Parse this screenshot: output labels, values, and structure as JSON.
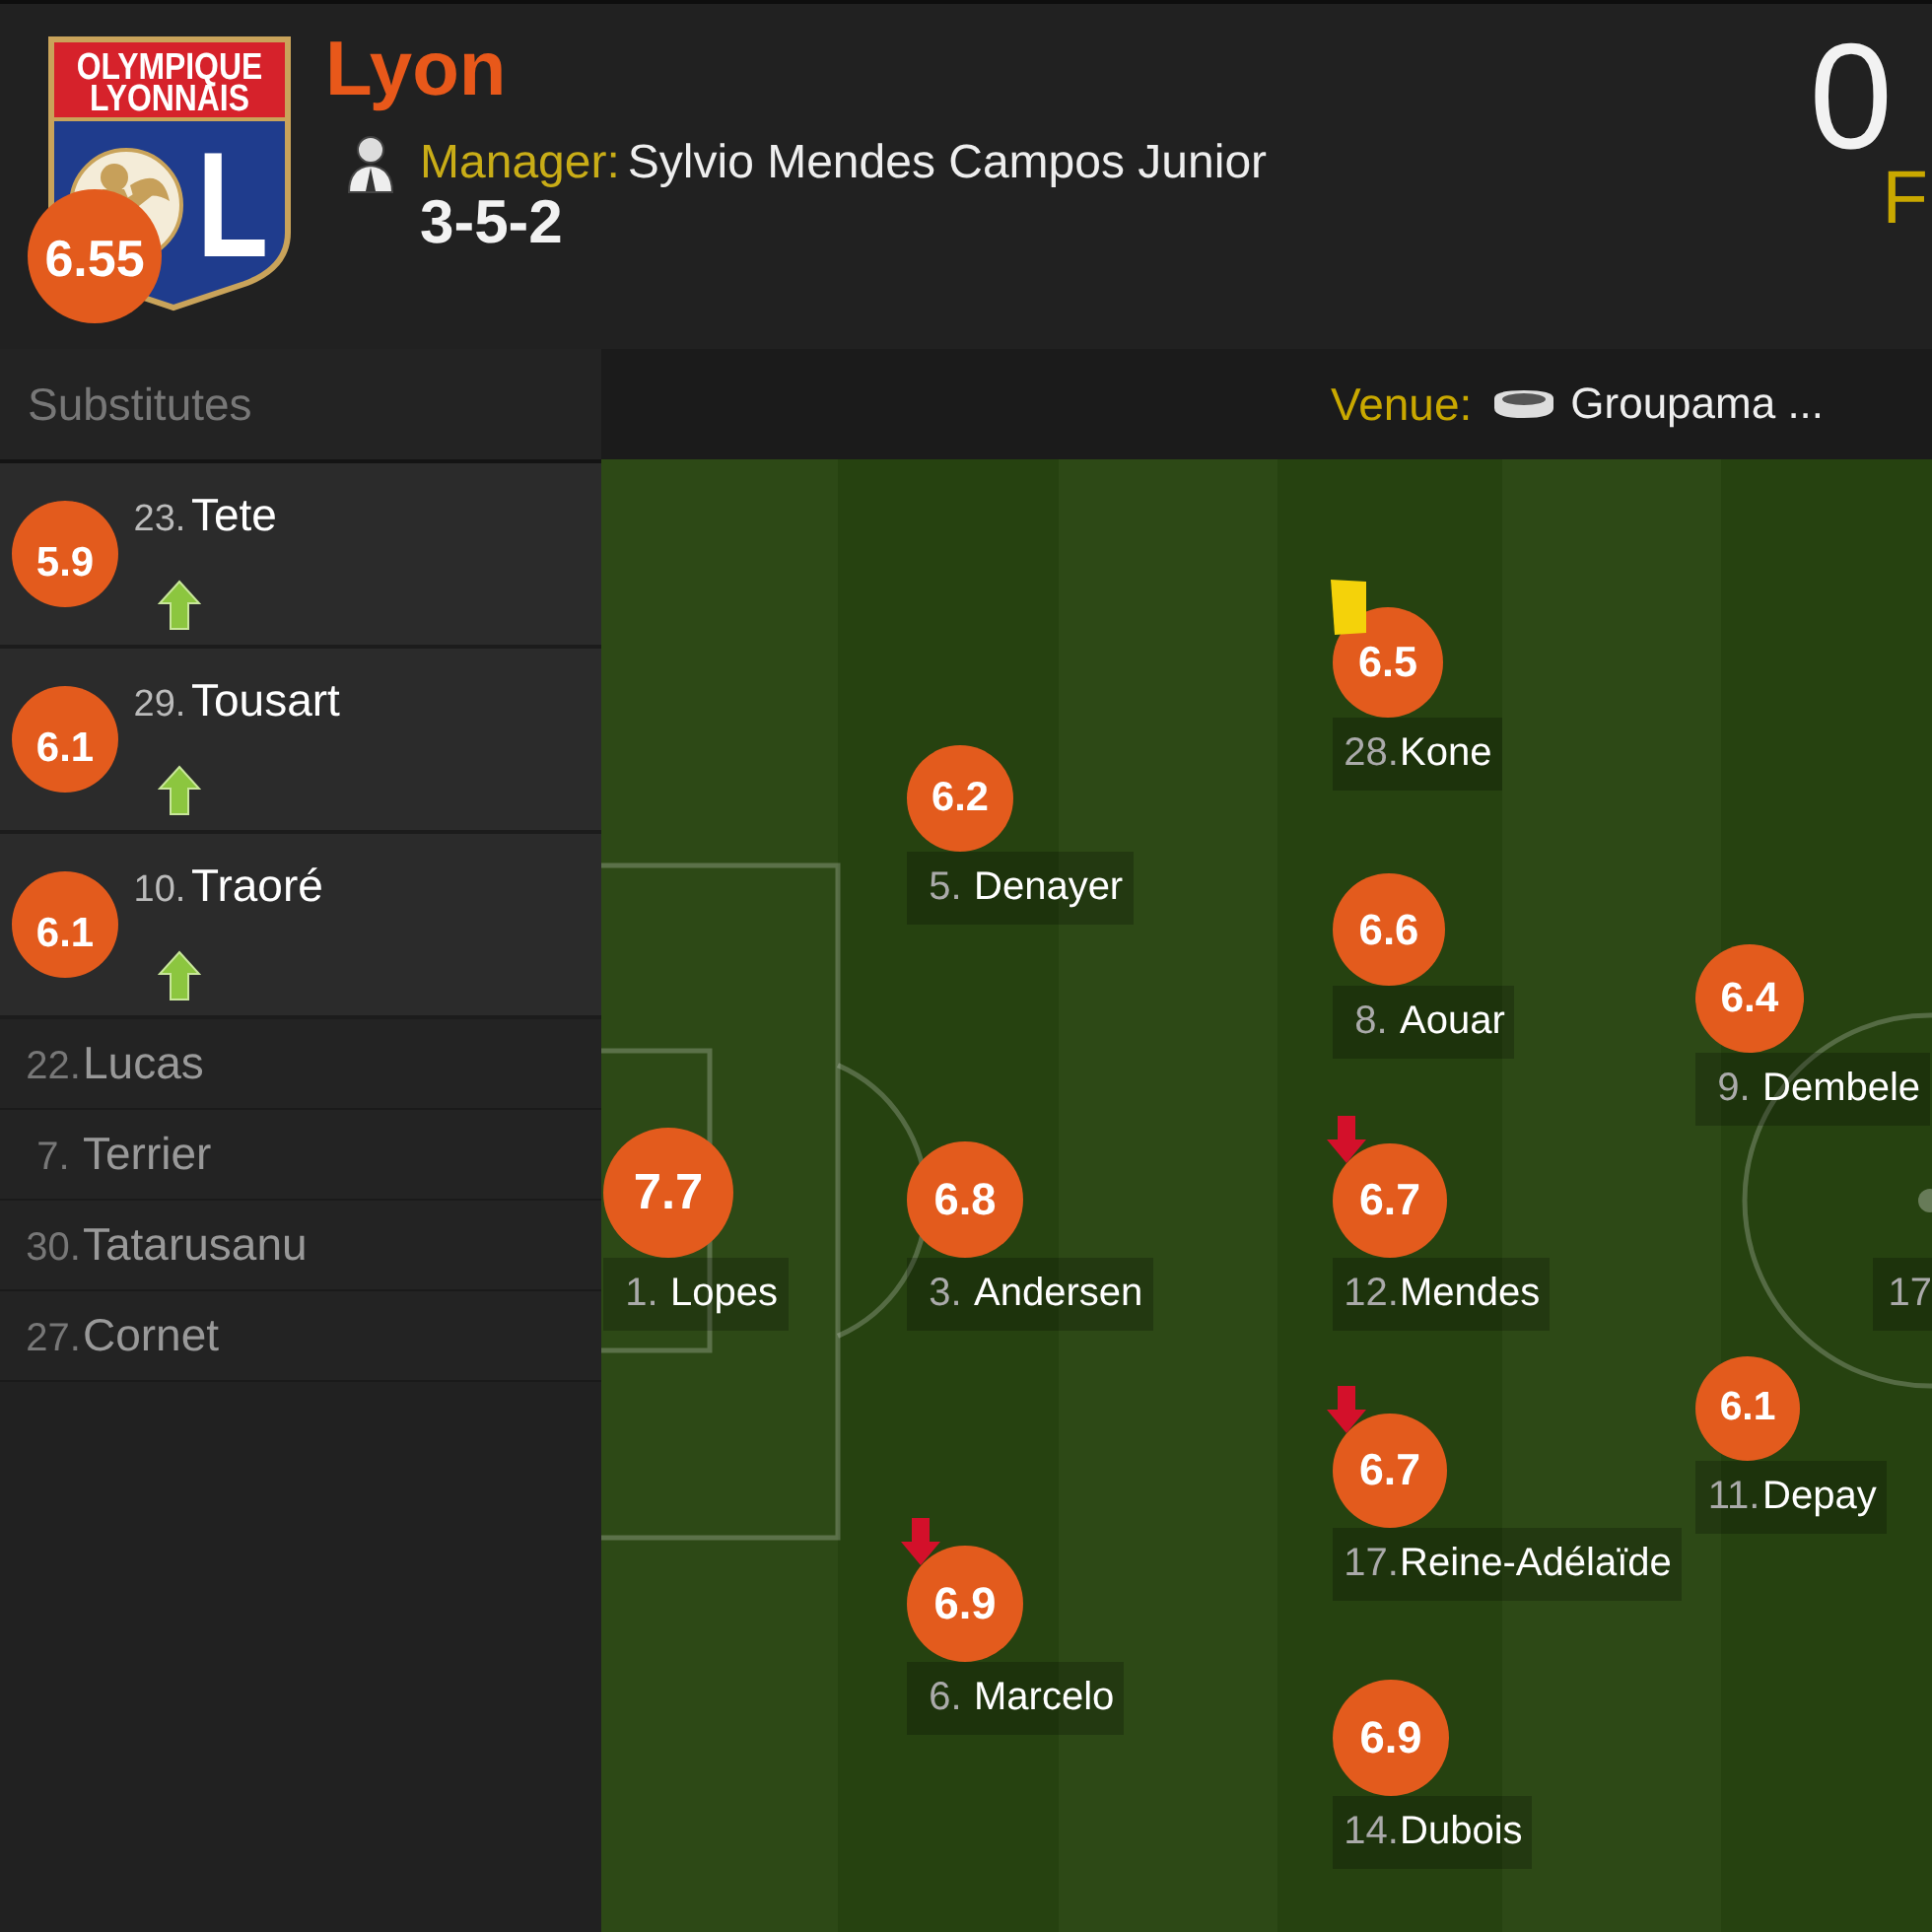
{
  "team": {
    "crest": {
      "lines": [
        "OLYMPIQUE",
        "LYONNAIS"
      ],
      "monogram": "L"
    },
    "rating": "6.55",
    "name": "Lyon",
    "manager_label": "Manager:",
    "manager": "Sylvio Mendes Campos Junior",
    "formation": "3-5-2"
  },
  "score": {
    "goals": "0",
    "status": "F"
  },
  "substitutes": {
    "title": "Substitutes",
    "players": [
      {
        "number": "23.",
        "name": "Tete",
        "rating": "5.9",
        "subbed_in": true
      },
      {
        "number": "29.",
        "name": "Tousart",
        "rating": "6.1",
        "subbed_in": true
      },
      {
        "number": "10.",
        "name": "Traoré",
        "rating": "6.1",
        "subbed_in": true
      },
      {
        "number": "22.",
        "name": "Lucas",
        "subbed_in": false
      },
      {
        "number": "7.",
        "name": "Terrier",
        "subbed_in": false
      },
      {
        "number": "30.",
        "name": "Tatarusanu",
        "subbed_in": false
      },
      {
        "number": "27.",
        "name": "Cornet",
        "subbed_in": false
      }
    ]
  },
  "venue": {
    "label": "Venue:",
    "name": "Groupama ..."
  },
  "pitch": {
    "lines": [
      {
        "players": [
          {
            "number": "1.",
            "name": "Lopes",
            "rating": "7.7",
            "subbed_off": false,
            "booked": false
          }
        ]
      },
      {
        "players": [
          {
            "number": "5.",
            "name": "Denayer",
            "rating": "6.2",
            "subbed_off": false,
            "booked": false
          },
          {
            "number": "3.",
            "name": "Andersen",
            "rating": "6.8",
            "subbed_off": false,
            "booked": false
          },
          {
            "number": "6.",
            "name": "Marcelo",
            "rating": "6.9",
            "subbed_off": true,
            "booked": false
          }
        ]
      },
      {
        "players": [
          {
            "number": "28.",
            "name": "Kone",
            "rating": "6.5",
            "subbed_off": false,
            "booked": true
          },
          {
            "number": "8.",
            "name": "Aouar",
            "rating": "6.6",
            "subbed_off": false,
            "booked": false
          },
          {
            "number": "12.",
            "name": "Mendes",
            "rating": "6.7",
            "subbed_off": true,
            "booked": false
          },
          {
            "number": "17.",
            "name": "Reine-Adélaïde",
            "rating": "6.7",
            "subbed_off": true,
            "booked": false
          },
          {
            "number": "14.",
            "name": "Dubois",
            "rating": "6.9",
            "subbed_off": false,
            "booked": false
          }
        ]
      },
      {
        "players": [
          {
            "number": "9.",
            "name": "Dembele",
            "rating": "6.4",
            "subbed_off": false,
            "booked": false
          },
          {
            "number": "11.",
            "name": "Depay",
            "rating": "6.1",
            "subbed_off": false,
            "booked": false
          }
        ]
      }
    ],
    "opponents": [
      {
        "number": "17"
      }
    ]
  }
}
